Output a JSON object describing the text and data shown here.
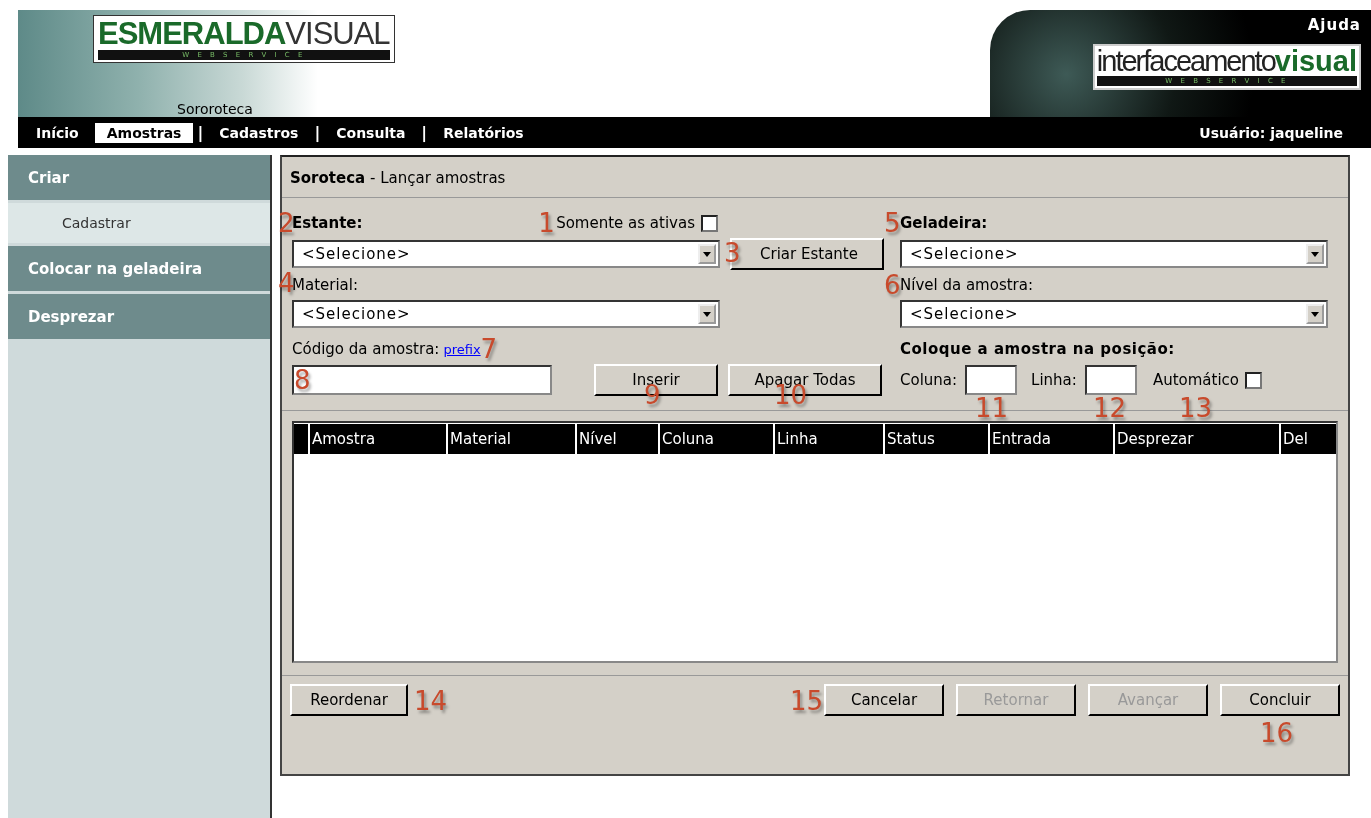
{
  "header": {
    "logo_left": {
      "text": "**ESMERALDA**VISUAL",
      "tagline": "W E B S E R V I C E"
    },
    "site_name": "Sororoteca",
    "help": "Ajuda",
    "logo_right": {
      "text": "interfaceamento**visual**",
      "tagline": "W E B S E R V I C E"
    }
  },
  "nav": {
    "items": [
      {
        "label": "Início",
        "selected": false
      },
      {
        "label": "Amostras",
        "selected": true
      },
      {
        "label": "Cadastros",
        "selected": false,
        "sep": "|"
      },
      {
        "label": "Consulta",
        "selected": false,
        "sep": "|"
      },
      {
        "label": "Relatórios",
        "selected": false,
        "sep": "|"
      }
    ],
    "user": "Usuário: jaqueline"
  },
  "sidebar": {
    "items": [
      {
        "label": "Criar",
        "kind": "header"
      },
      {
        "label": "Cadastrar",
        "kind": "sub"
      },
      {
        "label": "Colocar na geladeira",
        "kind": "header"
      },
      {
        "label": "Desprezar",
        "kind": "header"
      }
    ]
  },
  "panel": {
    "title_bold": "Soroteca",
    "title_rest": "- Lançar amostras",
    "estante": {
      "label": "Estante:",
      "callout": "2",
      "value": "<Selecione>"
    },
    "only_active": {
      "label": "Somente as ativas",
      "checked": false,
      "callout": "1"
    },
    "create_button": {
      "label": "Criar Estante",
      "callout": "3"
    },
    "material": {
      "label": "Material:",
      "callout": "4",
      "value": "<Selecione>"
    },
    "geladeira": {
      "label": "Geladeira:",
      "callout": "5",
      "value": "<Selecione>"
    },
    "nivel": {
      "label": "Nível da amostra:",
      "callout": "6",
      "value": "<Selecione>"
    },
    "codigo": {
      "label": "Código da amostra:",
      "link": "prefix",
      "callout": "7",
      "input_callout": "8"
    },
    "insert_button": {
      "label": "Inserir",
      "callout": "9"
    },
    "clear_button": {
      "label": "Apagar Todas",
      "callout": "10"
    },
    "position": {
      "heading": "Coloque a amostra na posição:",
      "coluna": "Coluna:",
      "coluna_callout": "11",
      "linha": "Linha:",
      "linha_callout": "12",
      "auto": "Automático",
      "auto_checked": false,
      "auto_callout": "13"
    },
    "table": {
      "columns": [
        "Amostra",
        "Material",
        "Nível",
        "Coluna",
        "Linha",
        "Status",
        "Entrada",
        "Desprezar",
        "Del"
      ]
    },
    "footer": [
      {
        "label": "Reordenar",
        "disabled": false,
        "callout": "14",
        "kind": "after"
      },
      {
        "label": "Cancelar",
        "disabled": false,
        "callout": "15",
        "kind": "before"
      },
      {
        "label": "Retornar",
        "disabled": true
      },
      {
        "label": "Avançar",
        "disabled": true
      },
      {
        "label": "Concluir",
        "disabled": false,
        "callout": "16",
        "kind": "below"
      }
    ]
  }
}
